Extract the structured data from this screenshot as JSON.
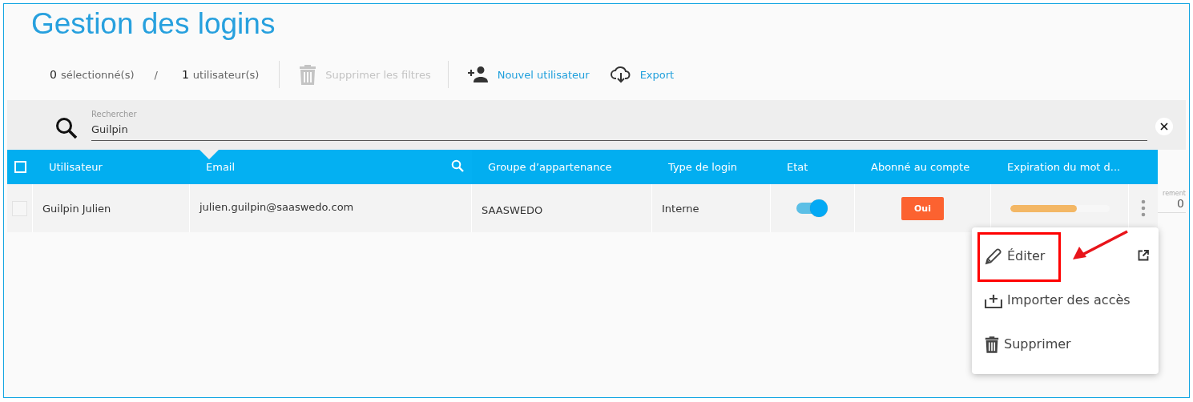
{
  "title": "Gestion des logins",
  "toolbar": {
    "selected_count": "0",
    "selected_label": "sélectionné(s)",
    "separator": "/",
    "user_count": "1",
    "user_label": "utilisateur(s)",
    "actions": [
      {
        "kind": "clear",
        "label": "Supprimer les filtres",
        "disabled": true
      },
      {
        "kind": "add-user",
        "label": "Nouvel utilisateur",
        "disabled": false
      },
      {
        "kind": "export",
        "label": "Export",
        "disabled": false
      }
    ]
  },
  "search": {
    "label": "Rechercher",
    "value": "Guilpin"
  },
  "table": {
    "all_checked": false,
    "columns": [
      {
        "label": "Utilisateur",
        "selected": false
      },
      {
        "label": "Email",
        "selected": true
      },
      {
        "label": "Groupe d’appartenance",
        "selected": false
      },
      {
        "label": "Type de login",
        "selected": false
      },
      {
        "label": "Etat",
        "selected": false
      },
      {
        "label": "Abonné au compte",
        "selected": false
      },
      {
        "label": "Expiration du mot d...",
        "selected": false
      }
    ],
    "rows": [
      {
        "checked": false,
        "user": "Guilpin Julien",
        "email": "julien.guilpin@saaswedo.com",
        "group": "SAASWEDO",
        "login_type": "Interne",
        "on": true,
        "subscribed": "Oui",
        "level": 0.67
      }
    ]
  },
  "side_panel": {
    "label": "rement",
    "value": "0"
  },
  "menu": {
    "items": [
      {
        "kind": "edit",
        "label": "Éditer"
      },
      {
        "kind": "import",
        "label": "Importer des accès"
      },
      {
        "kind": "delete",
        "label": "Supprimer"
      }
    ]
  }
}
